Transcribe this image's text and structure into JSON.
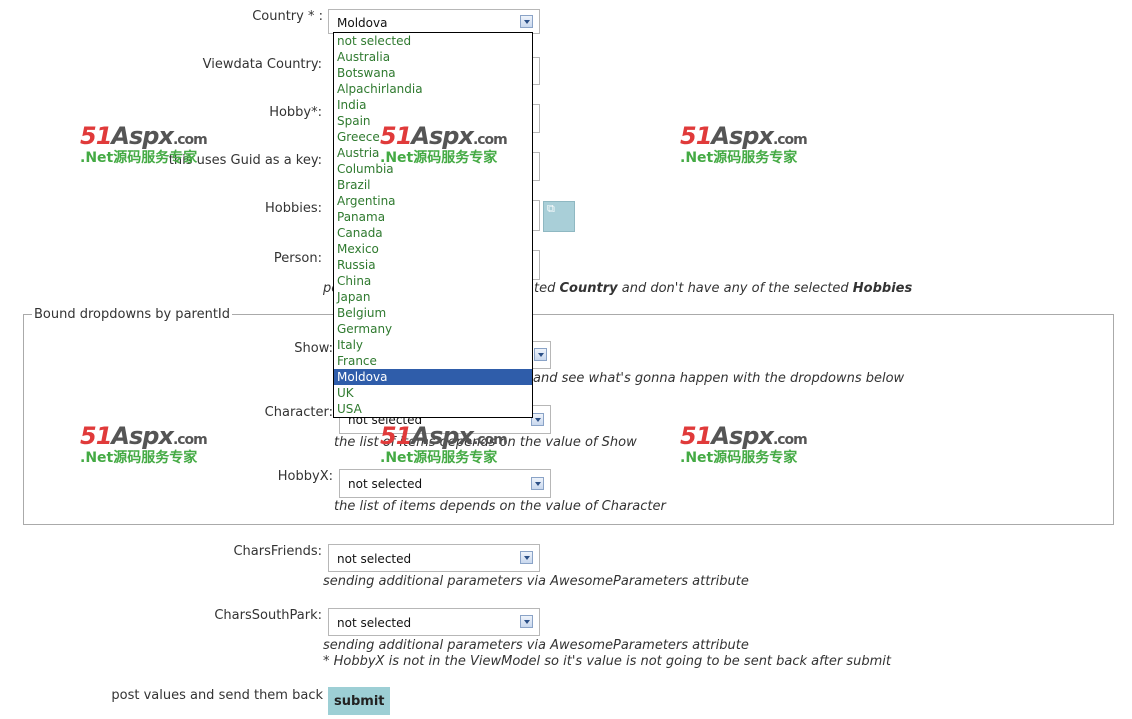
{
  "form": {
    "country_label": "Country * :",
    "country_value": "Moldova",
    "viewdata_country_label": "Viewdata Country:",
    "hobby_label": "Hobby*:",
    "guid_label": "this uses Guid as a key:",
    "hobbies_label": "Hobbies:",
    "person_label": "Person:",
    "person_hint_prefix": "pe",
    "person_hint_mid1": "ted",
    "person_hint_country": "Country",
    "person_hint_mid2": "and don't have any of the selected",
    "person_hint_hobbies": "Hobbies"
  },
  "country_dropdown": {
    "options": [
      "not selected",
      "Australia",
      "Botswana",
      "Alpachirlandia",
      "India",
      "Spain",
      "Greece",
      "Austria",
      "Columbia",
      "Brazil",
      "Argentina",
      "Panama",
      "Canada",
      "Mexico",
      "Russia",
      "China",
      "Japan",
      "Belgium",
      "Germany",
      "Italy",
      "France",
      "Moldova",
      "UK",
      "USA"
    ],
    "highlighted": "Moldova"
  },
  "bound": {
    "legend": "Bound dropdowns by parentId",
    "show_label": "Show:",
    "show_hint": "and see what's gonna happen with the dropdowns below",
    "character_label": "Character:",
    "character_value": "not selected",
    "character_hint": "the list of items depends on the value of Show",
    "hobbyx_label": "HobbyX:",
    "hobbyx_value": "not selected",
    "hobbyx_hint": "the list of items depends on the value of Character"
  },
  "chars": {
    "friends_label": "CharsFriends:",
    "friends_value": "not selected",
    "friends_hint": "sending additional parameters via AwesomeParameters attribute",
    "southpark_label": "CharsSouthPark:",
    "southpark_value": "not selected",
    "southpark_hint": "sending additional parameters via AwesomeParameters attribute",
    "note": "* HobbyX is not in the ViewModel so it's value is not going to be sent back after submit"
  },
  "footer": {
    "post_label": "post values and send them back",
    "submit_label": "submit"
  },
  "watermark": {
    "brand_51": "51",
    "brand_aspx": "Aspx",
    "brand_com": ".com",
    "tagline": ".Net源码服务专家"
  }
}
